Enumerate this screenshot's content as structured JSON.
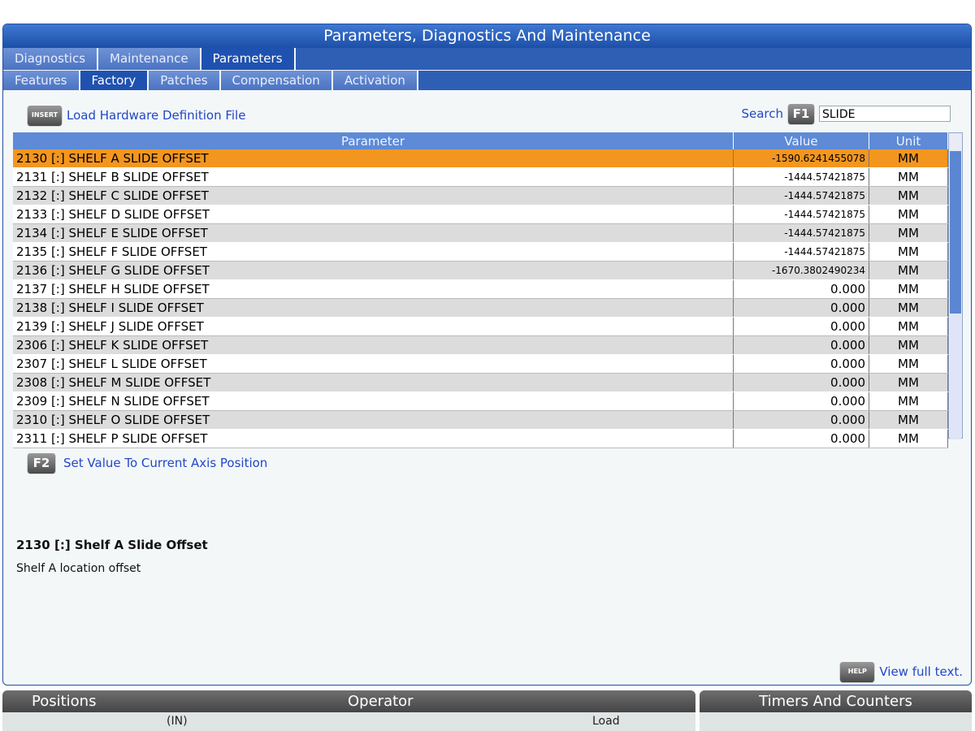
{
  "window": {
    "title": "Parameters, Diagnostics And Maintenance"
  },
  "main_tabs": [
    {
      "label": "Diagnostics",
      "active": false
    },
    {
      "label": "Maintenance",
      "active": false
    },
    {
      "label": "Parameters",
      "active": true
    }
  ],
  "sub_tabs": [
    {
      "label": "Features",
      "active": false
    },
    {
      "label": "Factory",
      "active": true
    },
    {
      "label": "Patches",
      "active": false
    },
    {
      "label": "Compensation",
      "active": false
    },
    {
      "label": "Activation",
      "active": false
    }
  ],
  "toolbar": {
    "insert_key": "INSERT",
    "insert_label": "Load Hardware Definition File",
    "search_label": "Search",
    "search_key": "F1",
    "search_value": "SLIDE"
  },
  "table": {
    "headers": {
      "parameter": "Parameter",
      "value": "Value",
      "unit": "Unit"
    },
    "rows": [
      {
        "parameter": "2130 [:] SHELF A SLIDE OFFSET",
        "value": "-1590.6241455078",
        "unit": "MM",
        "selected": true
      },
      {
        "parameter": "2131 [:] SHELF B SLIDE OFFSET",
        "value": "-1444.57421875",
        "unit": "MM"
      },
      {
        "parameter": "2132 [:] SHELF C SLIDE OFFSET",
        "value": "-1444.57421875",
        "unit": "MM"
      },
      {
        "parameter": "2133 [:] SHELF D SLIDE OFFSET",
        "value": "-1444.57421875",
        "unit": "MM"
      },
      {
        "parameter": "2134 [:] SHELF E SLIDE OFFSET",
        "value": "-1444.57421875",
        "unit": "MM"
      },
      {
        "parameter": "2135 [:] SHELF F SLIDE OFFSET",
        "value": "-1444.57421875",
        "unit": "MM"
      },
      {
        "parameter": "2136 [:] SHELF G SLIDE OFFSET",
        "value": "-1670.3802490234",
        "unit": "MM"
      },
      {
        "parameter": "2137 [:] SHELF H SLIDE OFFSET",
        "value": "0.000",
        "unit": "MM"
      },
      {
        "parameter": "2138 [:] SHELF I SLIDE OFFSET",
        "value": "0.000",
        "unit": "MM"
      },
      {
        "parameter": "2139 [:] SHELF J SLIDE OFFSET",
        "value": "0.000",
        "unit": "MM"
      },
      {
        "parameter": "2306 [:] SHELF K SLIDE OFFSET",
        "value": "0.000",
        "unit": "MM"
      },
      {
        "parameter": "2307 [:] SHELF L SLIDE OFFSET",
        "value": "0.000",
        "unit": "MM"
      },
      {
        "parameter": "2308 [:] SHELF M SLIDE OFFSET",
        "value": "0.000",
        "unit": "MM"
      },
      {
        "parameter": "2309 [:] SHELF N SLIDE OFFSET",
        "value": "0.000",
        "unit": "MM"
      },
      {
        "parameter": "2310 [:] SHELF O SLIDE OFFSET",
        "value": "0.000",
        "unit": "MM"
      },
      {
        "parameter": "2311 [:] SHELF P SLIDE OFFSET",
        "value": "0.000",
        "unit": "MM"
      }
    ]
  },
  "actions": {
    "f2_key": "F2",
    "f2_label": "Set Value To Current Axis Position",
    "help_key": "HELP",
    "help_label": "View full text."
  },
  "detail": {
    "title": "2130 [:] Shelf A Slide Offset",
    "description": "Shelf A location offset"
  },
  "bottom": {
    "positions_title": "Positions",
    "operator_title": "Operator",
    "units": "(IN)",
    "load_label": "Load",
    "timers_title": "Timers And Counters"
  },
  "colors": {
    "accent": "#2f5eb5",
    "selected_row": "#f39620",
    "link": "#2347c7"
  }
}
